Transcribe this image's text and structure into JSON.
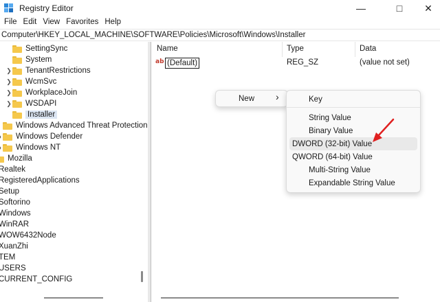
{
  "window": {
    "title": "Registry Editor",
    "minimize_glyph": "—",
    "maximize_glyph": "□",
    "close_glyph": "✕"
  },
  "menubar": [
    "File",
    "Edit",
    "View",
    "Favorites",
    "Help"
  ],
  "address": "Computer\\HKEY_LOCAL_MACHINE\\SOFTWARE\\Policies\\Microsoft\\Windows\\Installer",
  "tree": [
    {
      "label": "SettingSync",
      "has_children": false,
      "folder": true
    },
    {
      "label": "System",
      "has_children": false,
      "folder": true
    },
    {
      "label": "TenantRestrictions",
      "has_children": true,
      "folder": true
    },
    {
      "label": "WcmSvc",
      "has_children": true,
      "folder": true
    },
    {
      "label": "WorkplaceJoin",
      "has_children": true,
      "folder": true
    },
    {
      "label": "WSDAPI",
      "has_children": true,
      "folder": true
    },
    {
      "label": "Installer",
      "has_children": false,
      "folder": true,
      "selected": true
    },
    {
      "label": "Windows Advanced Threat Protection",
      "has_children": false,
      "folder": true
    },
    {
      "label": "Windows Defender",
      "has_children": true,
      "folder": true
    },
    {
      "label": "Windows NT",
      "has_children": true,
      "folder": true
    },
    {
      "label": "Mozilla",
      "has_children": false,
      "folder": true
    },
    {
      "label": "Realtek",
      "has_children": false,
      "folder": false
    },
    {
      "label": "RegisteredApplications",
      "has_children": false,
      "folder": false
    },
    {
      "label": "Setup",
      "has_children": false,
      "folder": false
    },
    {
      "label": "Softorino",
      "has_children": false,
      "folder": false
    },
    {
      "label": "Windows",
      "has_children": false,
      "folder": false
    },
    {
      "label": "WinRAR",
      "has_children": false,
      "folder": false
    },
    {
      "label": "WOW6432Node",
      "has_children": false,
      "folder": false
    },
    {
      "label": "XuanZhi",
      "has_children": false,
      "folder": false
    },
    {
      "label": "TEM",
      "has_children": false,
      "folder": false
    },
    {
      "label": "USERS",
      "has_children": false,
      "folder": false
    },
    {
      "label": "CURRENT_CONFIG",
      "has_children": false,
      "folder": false
    }
  ],
  "list": {
    "columns": [
      "Name",
      "Type",
      "Data"
    ],
    "rows": [
      {
        "name": "(Default)",
        "type": "REG_SZ",
        "data": "(value not set)",
        "icon": "ab"
      }
    ]
  },
  "context_menu": {
    "item": "New",
    "arrow": "›"
  },
  "submenu": {
    "items": [
      "Key",
      "String Value",
      "Binary Value",
      "DWORD (32-bit) Value",
      "QWORD (64-bit) Value",
      "Multi-String Value",
      "Expandable String Value"
    ],
    "highlighted": "DWORD (32-bit) Value"
  },
  "colors": {
    "annotation_arrow": "#e02020",
    "selection": "#dbe5f2",
    "folder": "#f5c84c"
  }
}
